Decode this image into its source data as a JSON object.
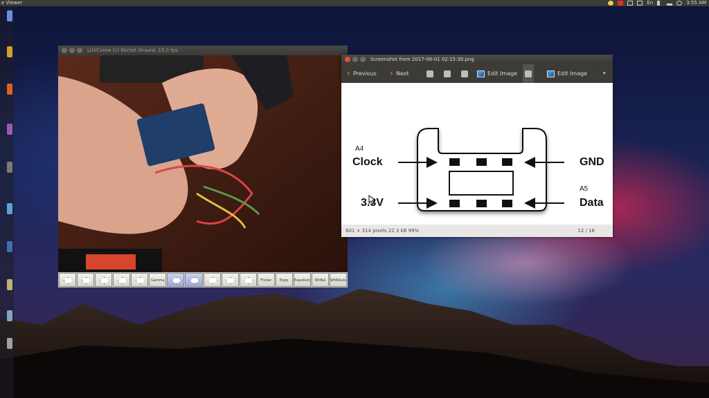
{
  "top_panel": {
    "app_title": "e Viewer",
    "indicators": [
      "",
      "",
      "",
      "",
      "En",
      "",
      "",
      ""
    ],
    "clock": "3:55 AM"
  },
  "luvcview": {
    "title": "LUVCview (c) Michel Xhaard, 15.0 fps",
    "toolbar_buttons": [
      "",
      "",
      "",
      "",
      "",
      "Gamma",
      "",
      "",
      "",
      "",
      "",
      "Flicker",
      "Expo",
      "ExpoAuto",
      "WhBal",
      "WhBAuto"
    ]
  },
  "viewer": {
    "title": "Screenshot from 2017-06-01 02:15:39.png",
    "previous_label": "Previous",
    "next_label": "Next",
    "edit_image_label": "Edit Image",
    "edit_image_label_2": "Edit Image",
    "status_info": "601 × 314 pixels  22.3 kB   99%",
    "page_counter": "12 / 16",
    "diagram": {
      "a4": "A4",
      "clock": "Clock",
      "gnd": "GND",
      "a5": "A5",
      "v33": "3.3V",
      "data": "Data"
    }
  },
  "colors": {
    "close_btn": "#e0503a",
    "win_btn": "#6d6c68",
    "arrow": "#e9642a",
    "panel": "#3c3b37"
  }
}
